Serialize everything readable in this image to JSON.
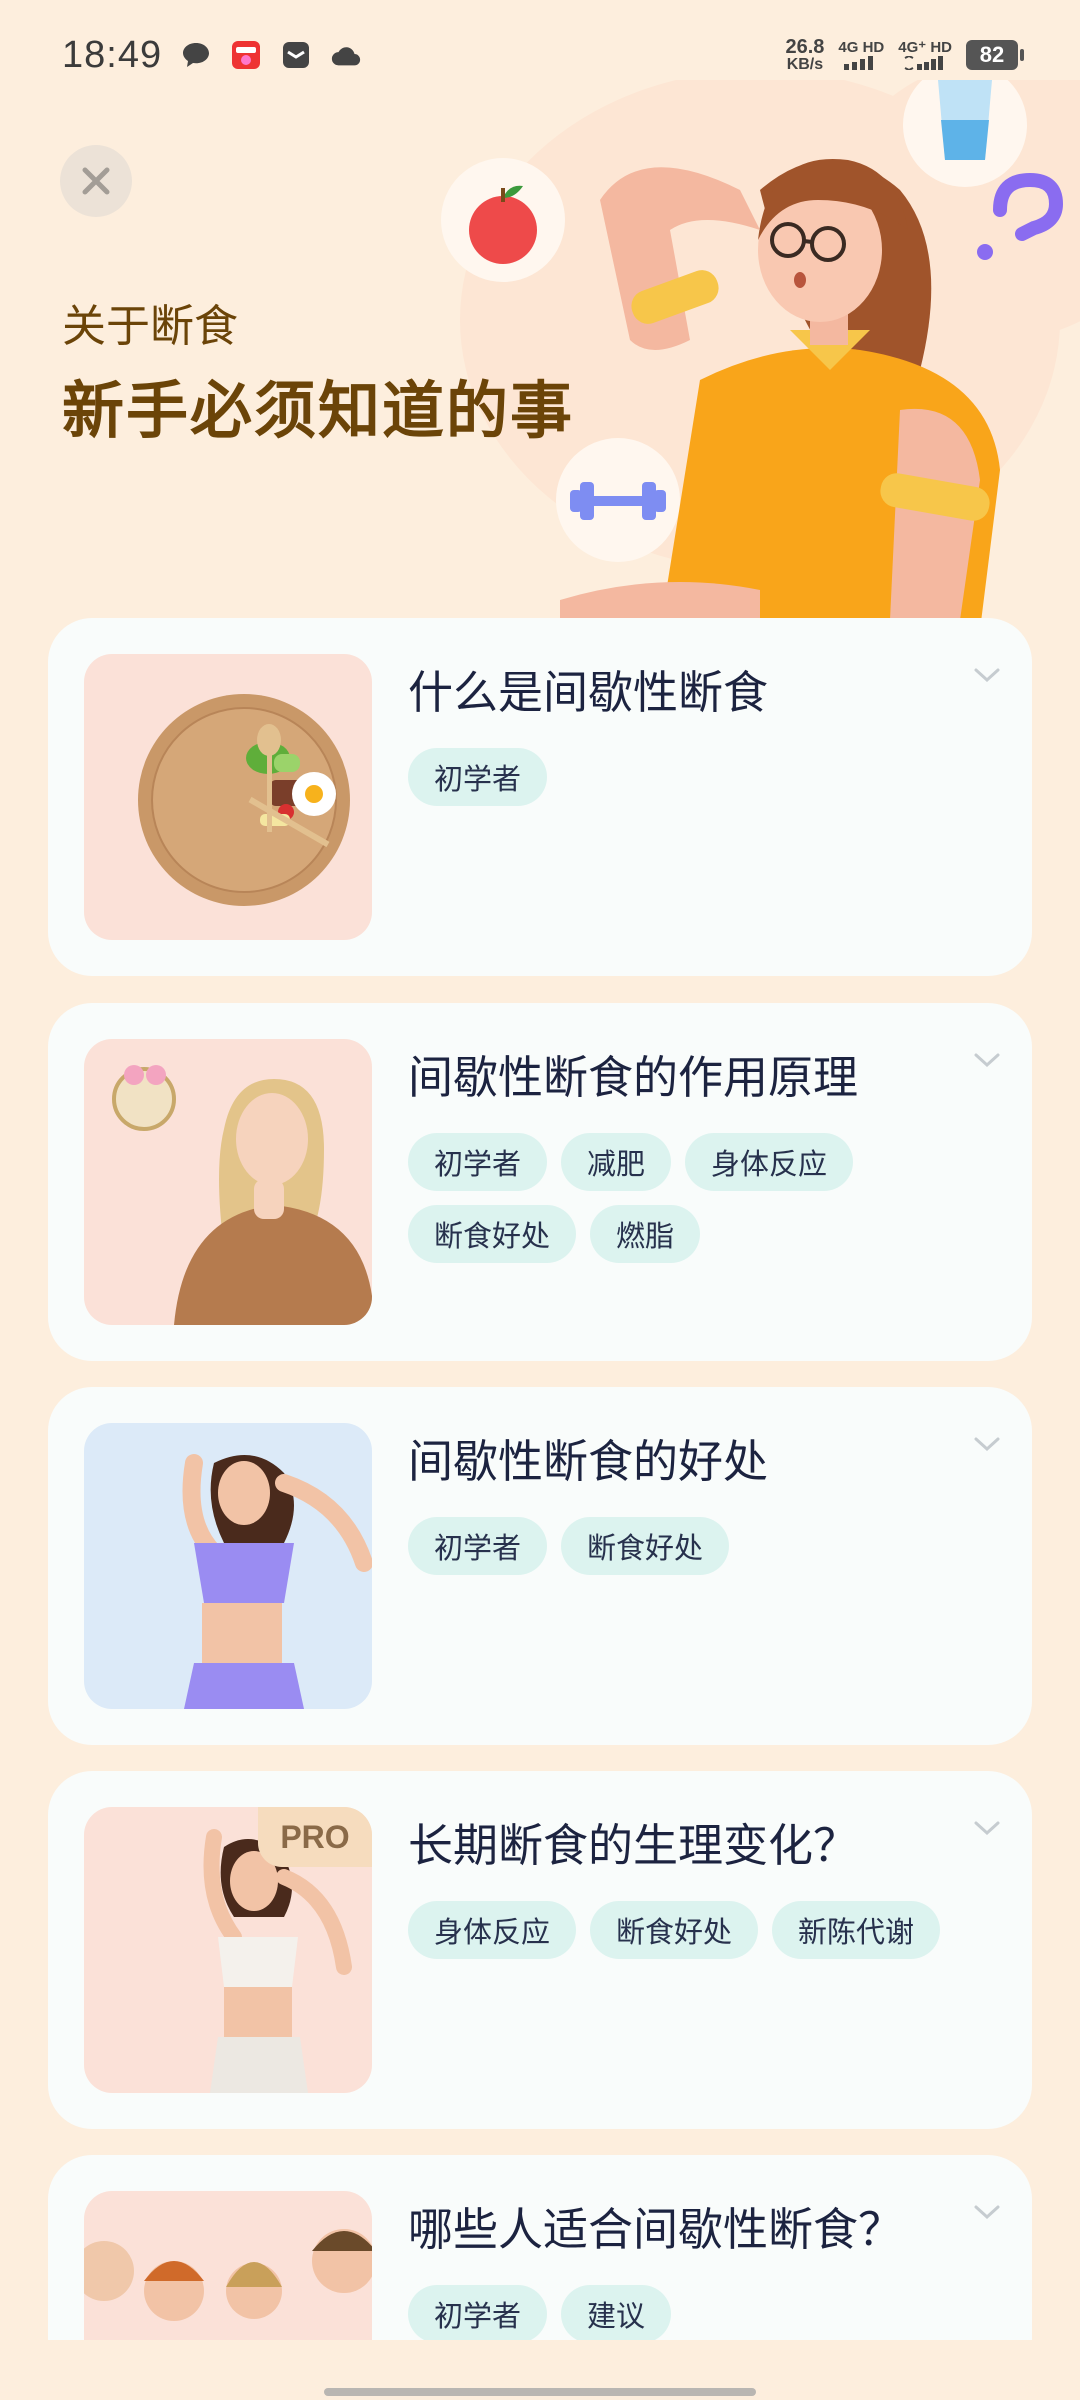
{
  "status_bar": {
    "time": "18:49",
    "net_speed_value": "26.8",
    "net_speed_unit": "KB/s",
    "sim1": "4G HD",
    "sim2": "4G⁺ HD",
    "battery": "82"
  },
  "hero": {
    "subtitle": "关于断食",
    "title": "新手必须知道的事"
  },
  "articles": [
    {
      "title": "什么是间歇性断食",
      "tags": [
        "初学者"
      ],
      "thumb_bg": "#fbe1d8",
      "thumb_icon": "food-plate-icon",
      "pro": false
    },
    {
      "title": "间歇性断食的作用原理",
      "tags": [
        "初学者",
        "减肥",
        "身体反应",
        "断食好处",
        "燃脂"
      ],
      "thumb_bg": "#fbe1d8",
      "thumb_icon": "thinking-woman-image",
      "pro": false
    },
    {
      "title": "间歇性断食的好处",
      "tags": [
        "初学者",
        "断食好处"
      ],
      "thumb_bg": "#dceaf8",
      "thumb_icon": "woman-purple-sportswear-image",
      "pro": false
    },
    {
      "title": "长期断食的生理变化？",
      "tags": [
        "身体反应",
        "断食好处",
        "新陈代谢"
      ],
      "thumb_bg": "#fbe1d8",
      "thumb_icon": "woman-white-sportswear-image",
      "pro": true,
      "pro_label": "PRO"
    },
    {
      "title": "哪些人适合间歇性断食？",
      "tags": [
        "初学者",
        "建议"
      ],
      "thumb_bg": "#fbe1d8",
      "thumb_icon": "group-of-people-image",
      "pro": false
    }
  ],
  "colors": {
    "page_bg": "#fdeedd",
    "card_bg": "#f9fcfb",
    "tag_bg": "#dcf3ef",
    "hero_text": "#6b4408"
  }
}
